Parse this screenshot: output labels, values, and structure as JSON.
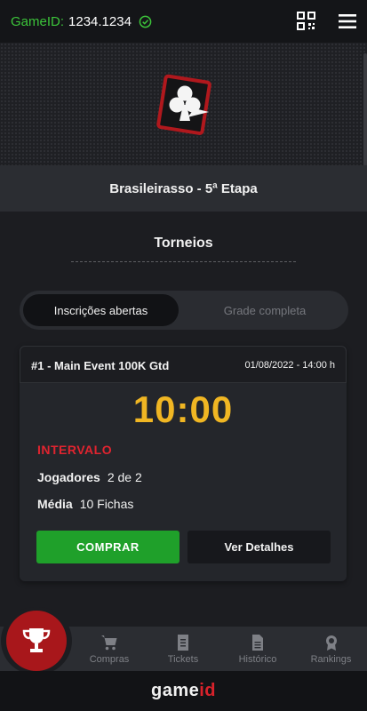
{
  "header": {
    "gameid_label": "GameID:",
    "gameid_value": "1234.1234",
    "icons": [
      "verified-check-icon",
      "qr-code-icon",
      "hamburger-menu-icon"
    ],
    "accent_color": "#3cc43a"
  },
  "hero": {
    "logo": "club-card-logo"
  },
  "stage": {
    "title": "Brasileirasso - 5ª Etapa"
  },
  "section": {
    "title": "Torneios"
  },
  "tabs": [
    {
      "label": "Inscrições abertas",
      "active": true
    },
    {
      "label": "Grade completa",
      "active": false
    }
  ],
  "tournament": {
    "name": "#1 - Main Event 100K Gtd",
    "date": "01/08/2022 - 14:00 h",
    "timer": "10:00",
    "status": "INTERVALO",
    "players_label": "Jogadores",
    "players_value": "2 de 2",
    "average_label": "Média",
    "average_value": "10 Fichas",
    "buy_label": "COMPRAR",
    "details_label": "Ver Detalhes",
    "timer_color": "#f0b623",
    "status_color": "#e0242f",
    "buy_color": "#1fa02a"
  },
  "nav": {
    "main_icon": "trophy-icon",
    "items": [
      {
        "label": "Compras",
        "icon": "cart-icon"
      },
      {
        "label": "Tickets",
        "icon": "ticket-icon"
      },
      {
        "label": "Histórico",
        "icon": "document-icon"
      },
      {
        "label": "Rankings",
        "icon": "medal-icon"
      }
    ]
  },
  "footer": {
    "brand_part1": "game",
    "brand_part2": "id"
  }
}
